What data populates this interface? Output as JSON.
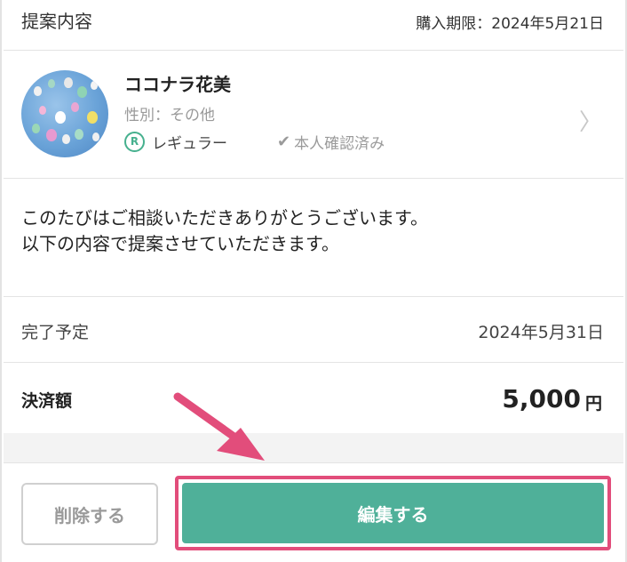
{
  "header": {
    "title": "提案内容",
    "deadline": "購入期限：2024年5月21日"
  },
  "profile": {
    "name": "ココナラ花美",
    "gender": "性別：その他",
    "rank_icon_letter": "R",
    "rank": "レギュラー",
    "verified": "本人確認済み"
  },
  "message": {
    "line1": "このたびはご相談いただきありがとうございます。",
    "line2": "以下の内容で提案させていただきます。"
  },
  "completion": {
    "label": "完了予定",
    "value": "2024年5月31日"
  },
  "payment": {
    "label": "決済額",
    "amount": "5,000",
    "unit": "円"
  },
  "buttons": {
    "delete": "削除する",
    "edit": "編集する"
  },
  "colors": {
    "accent": "#4fb099",
    "highlight": "#e24d7b",
    "rank": "#46b08e"
  }
}
